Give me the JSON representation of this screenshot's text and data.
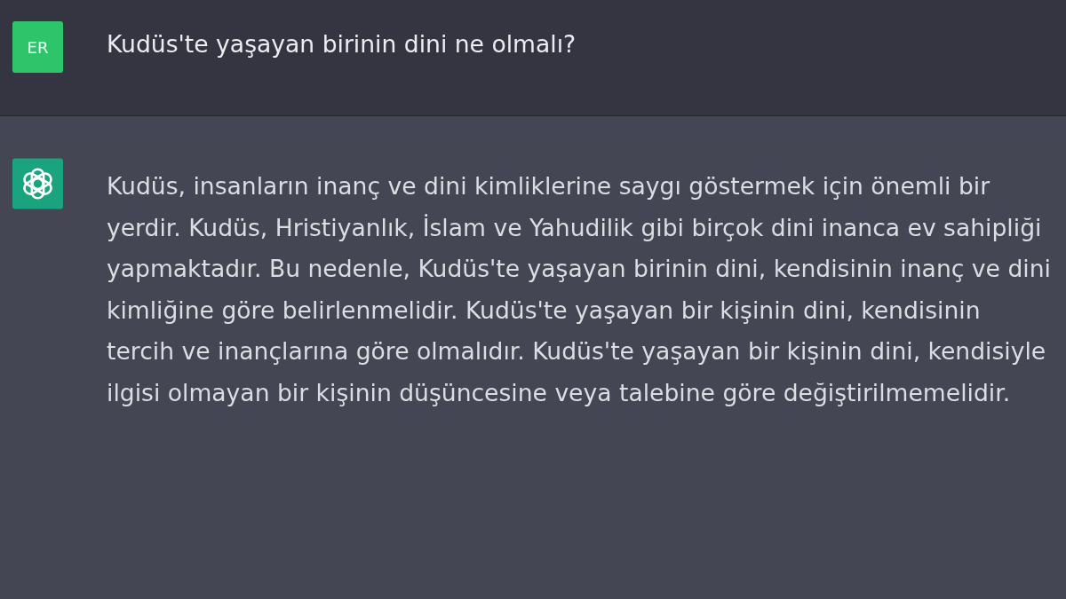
{
  "conversation": [
    {
      "kind": "user",
      "avatar": {
        "initials": "ER"
      },
      "text": "Kudüs'te yaşayan birinin dini ne olmalı?"
    },
    {
      "kind": "assistant",
      "text": "Kudüs, insanların inanç ve dini kimliklerine saygı göstermek için önemli bir yerdir. Kudüs, Hristiyanlık, İslam ve Yahudilik gibi birçok dini inanca ev sahipliği yapmaktadır. Bu nedenle, Kudüs'te yaşayan birinin dini, kendisinin inanç ve dini kimliğine göre belirlenmelidir. Kudüs'te yaşayan bir kişinin dini, kendisinin tercih ve inançlarına göre olmalıdır. Kudüs'te yaşayan bir kişinin dini, kendisiyle ilgisi olmayan bir kişinin düşüncesine veya talebine göre değiştirilmemelidir."
    }
  ]
}
